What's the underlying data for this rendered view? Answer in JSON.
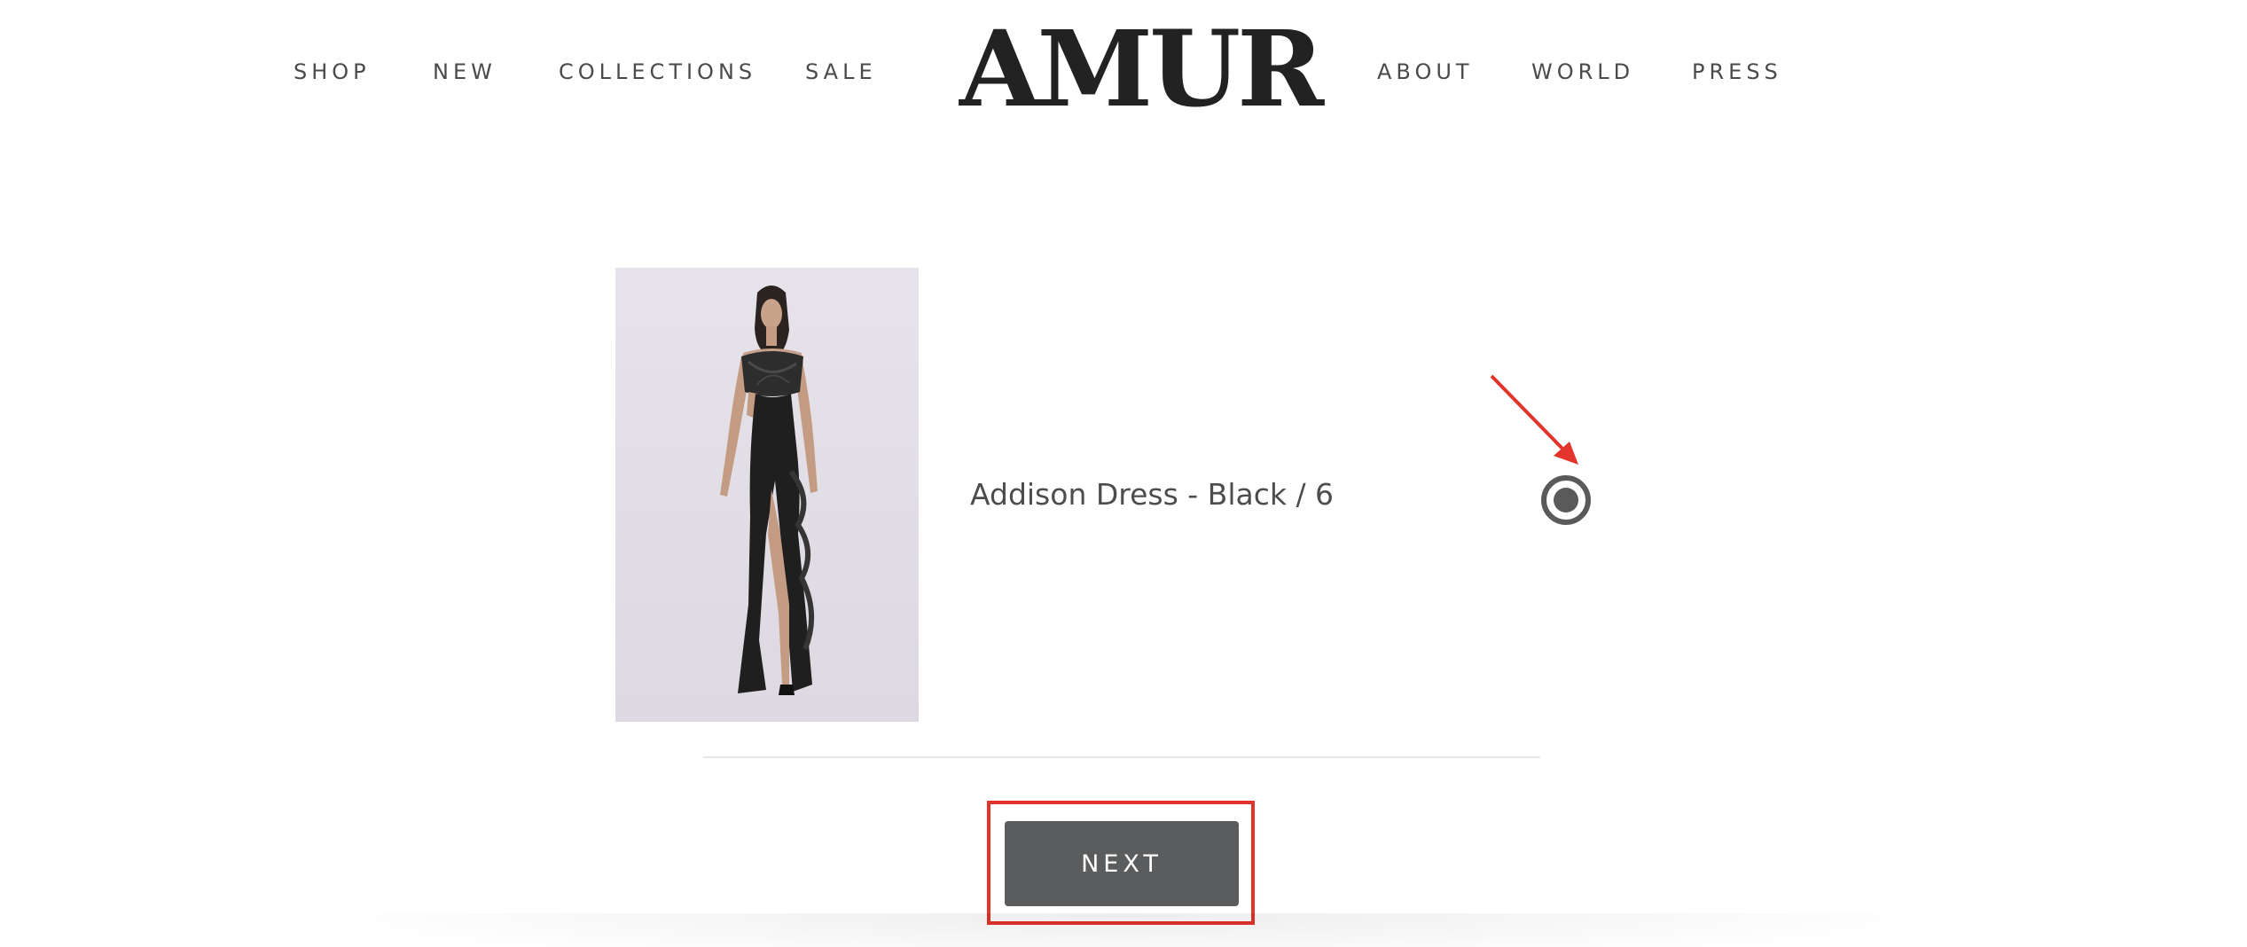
{
  "header": {
    "nav_left": [
      "SHOP",
      "NEW",
      "COLLECTIONS",
      "SALE"
    ],
    "logo": "AMUR",
    "nav_right": [
      "ABOUT",
      "WORLD",
      "PRESS"
    ]
  },
  "product": {
    "name": "Addison Dress - Black / 6",
    "selected": true
  },
  "actions": {
    "next_label": "NEXT"
  },
  "colors": {
    "button": "#5b5c5e",
    "annotation": "#e2342a",
    "radio": "#5a5a5a"
  },
  "icons": {
    "radio": "radio-selected-icon",
    "arrow": "red-arrow-annotation"
  }
}
